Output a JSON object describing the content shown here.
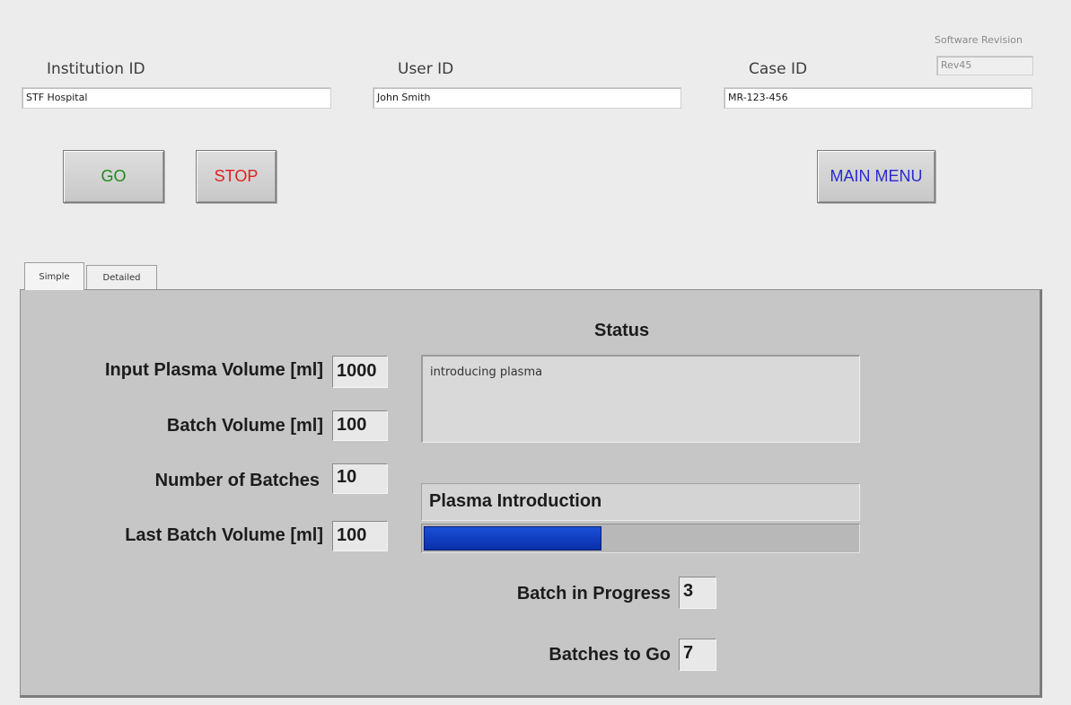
{
  "header": {
    "institution": {
      "label": "Institution ID",
      "value": "STF Hospital"
    },
    "user": {
      "label": "User ID",
      "value": "John Smith"
    },
    "case": {
      "label": "Case ID",
      "value": "MR-123-456"
    },
    "software": {
      "label": "Software Revision",
      "value": "Rev45"
    }
  },
  "buttons": {
    "go": "GO",
    "stop": "STOP",
    "main_menu": "MAIN MENU",
    "colors": {
      "go": "#1f8a1f",
      "stop": "#e02020",
      "main_menu": "#2a2acf"
    }
  },
  "tabs": [
    {
      "label": "Simple",
      "active": true
    },
    {
      "label": "Detailed",
      "active": false
    }
  ],
  "simple": {
    "input_plasma_volume": {
      "label": "Input Plasma Volume [ml]",
      "value": "1000"
    },
    "batch_volume": {
      "label": "Batch Volume [ml]",
      "value": "100"
    },
    "number_of_batches": {
      "label": "Number of Batches",
      "value": "10"
    },
    "last_batch_volume": {
      "label": "Last Batch Volume [ml]",
      "value": "100"
    },
    "status": {
      "title": "Status",
      "text": "introducing plasma"
    },
    "phase": {
      "label": "Plasma Introduction",
      "progress_fraction": 0.41,
      "bar_color": "#1242c4"
    },
    "batch_in_progress": {
      "label": "Batch in Progress",
      "value": "3"
    },
    "batches_to_go": {
      "label": "Batches to Go",
      "value": "7"
    }
  }
}
